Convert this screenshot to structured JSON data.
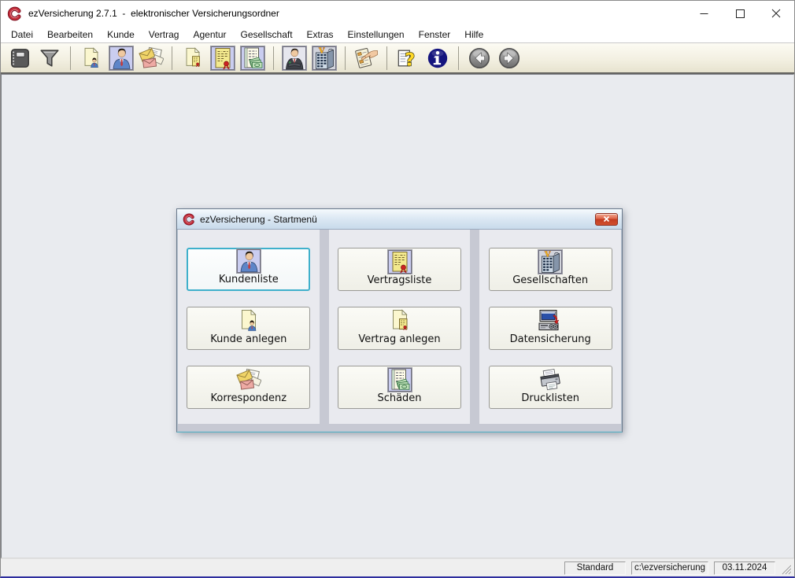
{
  "window": {
    "title": "ezVersicherung 2.7.1  -  elektronischer Versicherungsordner",
    "controls": [
      {
        "name": "minimize"
      },
      {
        "name": "maximize"
      },
      {
        "name": "close"
      }
    ]
  },
  "menu": {
    "items": [
      "Datei",
      "Bearbeiten",
      "Kunde",
      "Vertrag",
      "Agentur",
      "Gesellschaft",
      "Extras",
      "Einstellungen",
      "Fenster",
      "Hilfe"
    ]
  },
  "toolbar": {
    "buttons": [
      {
        "icon": "addressbook-icon"
      },
      {
        "icon": "filter-icon"
      },
      {
        "icon": "new-customer-icon"
      },
      {
        "icon": "customer-list-icon"
      },
      {
        "icon": "correspondence-icon"
      },
      {
        "icon": "new-contract-icon"
      },
      {
        "icon": "contract-list-icon"
      },
      {
        "icon": "claims-icon"
      },
      {
        "icon": "agent-icon"
      },
      {
        "icon": "companies-icon"
      },
      {
        "icon": "print-selection-icon"
      },
      {
        "icon": "help-icon"
      },
      {
        "icon": "info-icon"
      },
      {
        "icon": "nav-back-icon"
      },
      {
        "icon": "nav-forward-icon"
      }
    ]
  },
  "dialog": {
    "title": "ezVersicherung - Startmenü",
    "columns": [
      {
        "buttons": [
          {
            "label": "Kundenliste",
            "icon": "customer-list-icon",
            "focused": true
          },
          {
            "label": "Kunde anlegen",
            "icon": "new-customer-icon"
          },
          {
            "label": "Korrespondenz",
            "icon": "correspondence-icon"
          }
        ]
      },
      {
        "buttons": [
          {
            "label": "Vertragsliste",
            "icon": "contract-list-icon"
          },
          {
            "label": "Vertrag anlegen",
            "icon": "new-contract-icon"
          },
          {
            "label": "Schäden",
            "icon": "claims-icon"
          }
        ]
      },
      {
        "buttons": [
          {
            "label": "Gesellschaften",
            "icon": "companies-icon"
          },
          {
            "label": "Datensicherung",
            "icon": "backup-icon"
          },
          {
            "label": "Drucklisten",
            "icon": "print-lists-icon"
          }
        ]
      }
    ]
  },
  "statusbar": {
    "fields": [
      "Standard",
      "c:\\ezversicherung",
      "03.11.2024"
    ]
  },
  "colors": {
    "focus_accent": "#3fb0cb",
    "toolbar_bg": "#f3f0e2",
    "dialog_gap": "#c7c9d3",
    "close_button": "#c03a20"
  }
}
